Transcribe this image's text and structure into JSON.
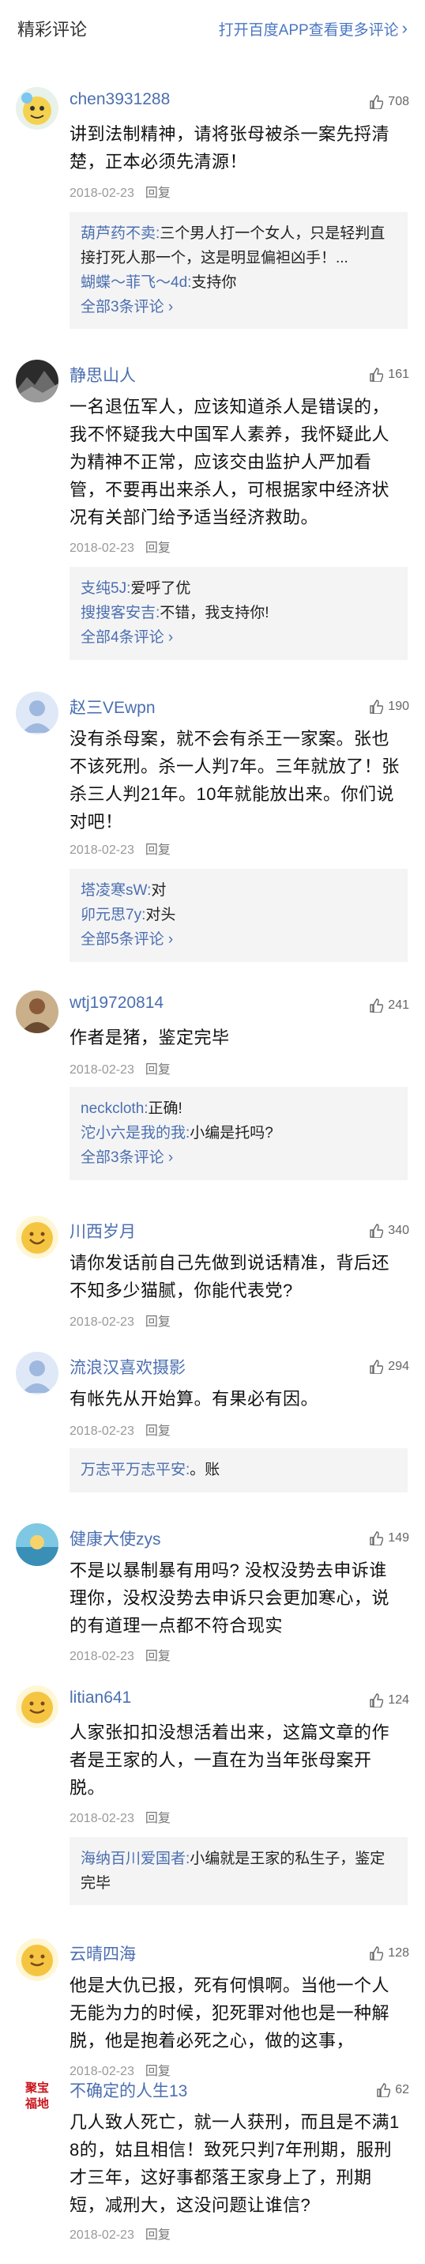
{
  "header": {
    "title": "精彩评论",
    "link": "打开百度APP查看更多评论",
    "link_chevron": "›"
  },
  "comments": [
    {
      "user": "chen3931288",
      "likes": "708",
      "lines": [
        "讲到法制精神，请将张母被杀一案先捋清",
        "楚，正本必须先清源！"
      ],
      "date": "2018-02-23",
      "reply_label": "回复",
      "replies": [
        {
          "user": "葫芦药不卖:",
          "text": "三个男人打一个女人，只是轻判直接打死人那一个，这是明显偏袒凶手！..."
        },
        {
          "user": "蝴蝶～菲飞～4d:",
          "text": "支持你"
        }
      ],
      "more": "全部3条评论 ›"
    },
    {
      "user": "静思山人",
      "likes": "161",
      "lines": [
        "一名退伍军人，应该知道杀人是错误的，",
        "我不怀疑我大中国军人素养，我怀疑此人",
        "为精神不正常，应该交由监护人严加看",
        "管，不要再出来杀人，可根据家中经济状",
        "况有关部门给予适当经济救助。"
      ],
      "date": "2018-02-23",
      "reply_label": "回复",
      "replies": [
        {
          "user": "支纯5J:",
          "text": "爱呼了优"
        },
        {
          "user": "搜搜客安吉:",
          "text": "不错，我支持你!"
        }
      ],
      "more": "全部4条评论 ›"
    },
    {
      "user": "赵三VEwpn",
      "likes": "190",
      "lines": [
        "没有杀母案，就不会有杀王一家案。张也",
        "不该死刑。杀一人判7年。三年就放了！张",
        "杀三人判21年。10年就能放出来。你们说",
        "对吧！"
      ],
      "date": "2018-02-23",
      "reply_label": "回复",
      "replies": [
        {
          "user": "塔凌寒sW:",
          "text": "对"
        },
        {
          "user": "卯元思7y:",
          "text": "对头"
        }
      ],
      "more": "全部5条评论 ›"
    },
    {
      "user": "wtj19720814",
      "likes": "241",
      "lines": [
        "作者是猪，鉴定完毕"
      ],
      "date": "2018-02-23",
      "reply_label": "回复",
      "replies": [
        {
          "user": "neckcloth:",
          "text": "正确!"
        },
        {
          "user": "沱小六是我的我:",
          "text": "小编是托吗?"
        }
      ],
      "more": "全部3条评论 ›"
    },
    {
      "user": "川西岁月",
      "likes": "340",
      "lines": [
        "请你发话前自己先做到说话精准，背后还",
        "不知多少猫腻，你能代表党?"
      ],
      "date": "2018-02-23",
      "reply_label": "回复",
      "replies": [],
      "more": ""
    },
    {
      "user": "流浪汉喜欢摄影",
      "likes": "294",
      "lines": [
        "有帐先从开始算。有果必有因。"
      ],
      "date": "2018-02-23",
      "reply_label": "回复",
      "replies": [
        {
          "user": "万志平万志平安:",
          "text": "。账"
        }
      ],
      "more": ""
    },
    {
      "user": "健康大使zys",
      "likes": "149",
      "lines": [
        "不是以暴制暴有用吗? 没权没势去申诉谁",
        "理你，没权没势去申诉只会更加寒心，说",
        "的有道理一点都不符合现实"
      ],
      "date": "2018-02-23",
      "reply_label": "回复",
      "replies": [],
      "more": ""
    },
    {
      "user": "litian641",
      "likes": "124",
      "lines": [
        "人家张扣扣没想活着出来，这篇文章的作",
        "者是王家的人，一直在为当年张母案开",
        "脱。"
      ],
      "date": "2018-02-23",
      "reply_label": "回复",
      "replies": [
        {
          "user": "海纳百川爱国者:",
          "text": "小编就是王家的私生子，鉴定完毕"
        }
      ],
      "more": ""
    },
    {
      "user": "云晴四海",
      "likes": "128",
      "lines": [
        "他是大仇已报，死有何惧啊。当他一个人",
        "无能为力的时候，犯死罪对他也是一种解",
        "脱，他是抱着必死之心，做的这事，"
      ],
      "date": "2018-02-23",
      "reply_label": "回复",
      "replies": [],
      "more": ""
    },
    {
      "user": "不确定的人生13",
      "likes": "62",
      "lines": [
        "几人致人死亡，就一人获刑，而且是不满1",
        "8的，姑且相信！致死只判7年刑期，服刑",
        "才三年，这好事都落王家身上了，刑期",
        "短，减刑大，这没问题让谁信?"
      ],
      "date": "2018-02-23",
      "reply_label": "回复",
      "replies": [],
      "more": ""
    }
  ],
  "avatar_badge": [
    "聚宝",
    "福地"
  ],
  "colors": {
    "link": "#4a77c2",
    "username": "#4b6fb0",
    "meta": "#999999",
    "reply_bg": "#f4f4f4"
  }
}
